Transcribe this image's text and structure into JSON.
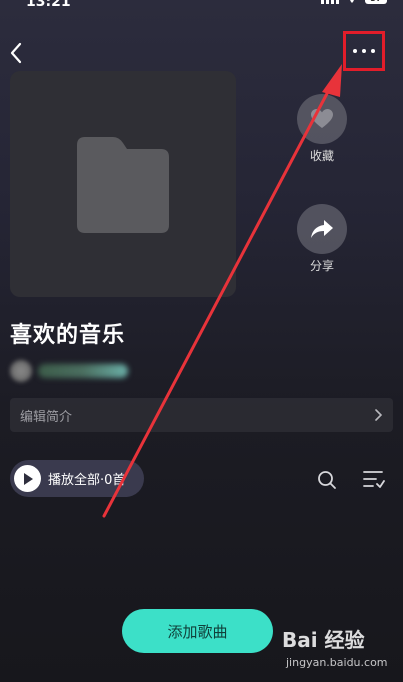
{
  "status_bar": {
    "time": "13:21",
    "battery": "37"
  },
  "header": {
    "back_icon": "chevron-left-icon",
    "more_icon": "more-dots-icon"
  },
  "cover": {
    "icon": "folder-icon"
  },
  "actions": {
    "favorite": {
      "label": "收藏",
      "icon": "heart-icon"
    },
    "share": {
      "label": "分享",
      "icon": "share-arrow-icon"
    }
  },
  "playlist": {
    "title": "喜欢的音乐"
  },
  "description": {
    "label": "编辑简介"
  },
  "play_all": {
    "label": "播放全部·0首"
  },
  "toolbar": {
    "search_icon": "search-icon",
    "sort_icon": "sort-list-icon"
  },
  "add_song": {
    "label": "添加歌曲"
  },
  "watermark": {
    "brand": "Bai 经验",
    "url": "jingyan.baidu.com"
  },
  "colors": {
    "accent": "#3ce0c8",
    "highlight_box": "#e21d2a",
    "annotation_arrow": "#e8333a"
  }
}
